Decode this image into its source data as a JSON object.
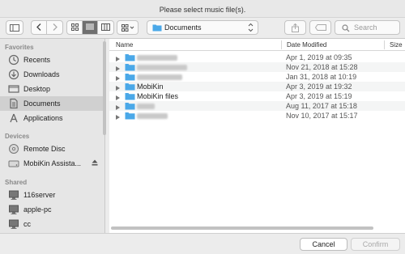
{
  "window": {
    "title": "Please select music file(s)."
  },
  "toolbar": {
    "location": "Documents",
    "search_placeholder": "Search",
    "icons": [
      "sidebar-toggle-icon",
      "back-icon",
      "forward-icon",
      "icon-view-icon",
      "list-view-icon",
      "column-view-icon",
      "group-by-icon",
      "share-icon",
      "tag-icon",
      "search-icon"
    ]
  },
  "sidebar": {
    "sections": [
      {
        "label": "Favorites",
        "items": [
          {
            "label": "Recents",
            "icon": "clock-icon"
          },
          {
            "label": "Downloads",
            "icon": "download-icon"
          },
          {
            "label": "Desktop",
            "icon": "desktop-icon"
          },
          {
            "label": "Documents",
            "icon": "documents-icon",
            "selected": true
          },
          {
            "label": "Applications",
            "icon": "applications-icon"
          }
        ]
      },
      {
        "label": "Devices",
        "items": [
          {
            "label": "Remote Disc",
            "icon": "disc-icon"
          },
          {
            "label": "MobiKin Assista...",
            "icon": "drive-icon",
            "eject": true
          }
        ]
      },
      {
        "label": "Shared",
        "items": [
          {
            "label": "116server",
            "icon": "monitor-icon"
          },
          {
            "label": "apple-pc",
            "icon": "monitor-icon"
          },
          {
            "label": "cc",
            "icon": "monitor-icon"
          }
        ]
      }
    ]
  },
  "columns": {
    "name": "Name",
    "date": "Date Modified",
    "size": "Size"
  },
  "files": [
    {
      "name": "",
      "date": "Apr 1, 2019 at 09:35",
      "redacted": true
    },
    {
      "name": "",
      "date": "Nov 21, 2018 at 15:28",
      "redacted": true
    },
    {
      "name": "",
      "date": "Jan 31, 2018 at 10:19",
      "redacted": true
    },
    {
      "name": "MobiKin",
      "date": "Apr 3, 2019 at 19:32",
      "redacted": false
    },
    {
      "name": "MobiKin files",
      "date": "Apr 3, 2019 at 15:19",
      "redacted": false
    },
    {
      "name": "",
      "date": "Aug 11, 2017 at 15:18",
      "redacted": true
    },
    {
      "name": "",
      "date": "Nov 10, 2017 at 15:17",
      "redacted": true
    }
  ],
  "footer": {
    "cancel_label": "Cancel",
    "confirm_label": "Confirm"
  },
  "colors": {
    "folder": "#4aa8e8",
    "selected_sidebar": "#d0d0d0",
    "active_segment": "#6f6f6f"
  }
}
